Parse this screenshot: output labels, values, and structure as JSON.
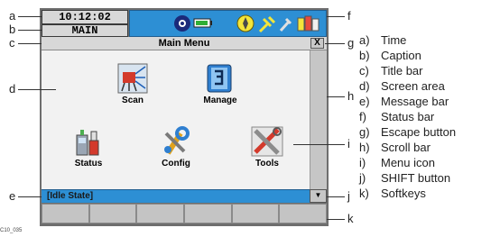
{
  "screen": {
    "time": "10:12:02",
    "caption": "MAIN",
    "title": "Main Menu",
    "escape_label": "X",
    "message": "[Idle State]",
    "shift_label": "▼",
    "menu_items": [
      {
        "label": "Scan",
        "icon": "scan-icon"
      },
      {
        "label": "Manage",
        "icon": "manage-icon"
      },
      {
        "label": "Status",
        "icon": "status-icon"
      },
      {
        "label": "Config",
        "icon": "config-icon"
      },
      {
        "label": "Tools",
        "icon": "tools-icon"
      }
    ],
    "softkey_count": 6
  },
  "callouts": {
    "a": "a",
    "b": "b",
    "c": "c",
    "d": "d",
    "e": "e",
    "f": "f",
    "g": "g",
    "h": "h",
    "i": "i",
    "j": "j",
    "k": "k"
  },
  "legend": [
    {
      "key": "a)",
      "text": "Time"
    },
    {
      "key": "b)",
      "text": "Caption"
    },
    {
      "key": "c)",
      "text": "Title bar"
    },
    {
      "key": "d)",
      "text": "Screen area"
    },
    {
      "key": "e)",
      "text": "Message bar"
    },
    {
      "key": "f)",
      "text": "Status bar"
    },
    {
      "key": "g)",
      "text": "Escape button"
    },
    {
      "key": "h)",
      "text": "Scroll bar"
    },
    {
      "key": "i)",
      "text": "Menu icon"
    },
    {
      "key": "j)",
      "text": "SHIFT button"
    },
    {
      "key": "k)",
      "text": "Softkeys"
    }
  ],
  "figure_code": "C10_035",
  "colors": {
    "status_bar": "#2d8fd4",
    "message_bar": "#2d8fd4",
    "screen_bg": "#f2f2f2",
    "bar_grey": "#d8d8d8"
  }
}
